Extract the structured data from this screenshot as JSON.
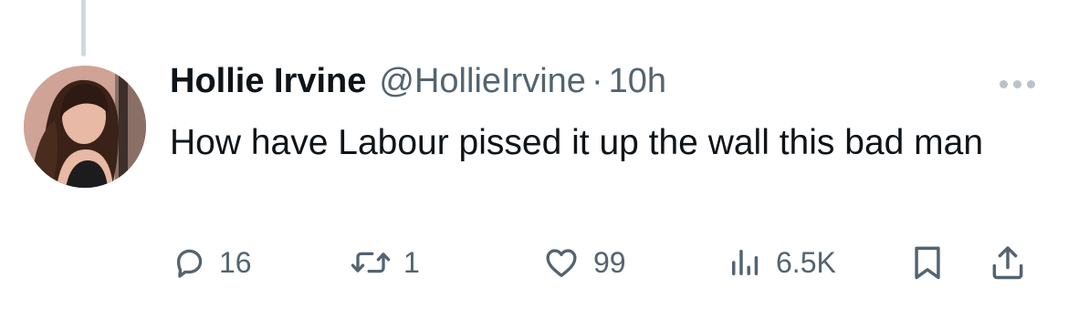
{
  "tweet": {
    "display_name": "Hollie Irvine",
    "handle": "@HollieIrvine",
    "separator": "·",
    "time": "10h",
    "text": "How have Labour pissed it up the wall this bad man"
  },
  "actions": {
    "replies": "16",
    "reposts": "1",
    "likes": "99",
    "views": "6.5K"
  },
  "icons": {
    "reply": "reply-icon",
    "repost": "repost-icon",
    "like": "heart-icon",
    "views": "views-icon",
    "bookmark": "bookmark-icon",
    "share": "share-icon",
    "more": "more-icon"
  },
  "colors": {
    "text": "#0f1419",
    "secondary": "#536471",
    "thread_line": "#cfd9de"
  }
}
